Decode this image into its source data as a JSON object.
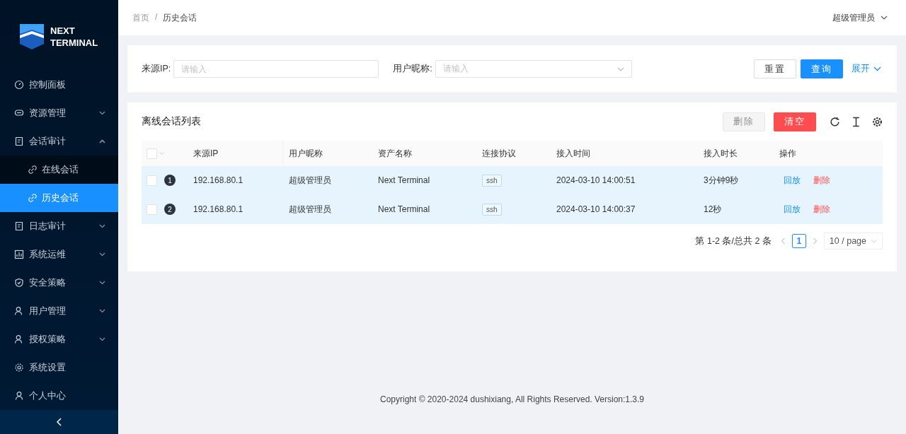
{
  "logo": {
    "line_1": "NEXT",
    "line_2": "TERMINAL"
  },
  "sidebar": {
    "items": [
      {
        "label": "控制面板",
        "selected": false
      },
      {
        "label": "资源管理",
        "selected": false,
        "expanded": false
      },
      {
        "label": "会话审计",
        "selected": false,
        "expanded": true,
        "children": [
          {
            "label": "在线会话",
            "selected": false
          },
          {
            "label": "历史会话",
            "selected": true
          }
        ]
      },
      {
        "label": "日志审计",
        "selected": false,
        "expanded": false
      },
      {
        "label": "系统运维",
        "selected": false,
        "expanded": false
      },
      {
        "label": "安全策略",
        "selected": false,
        "expanded": false
      },
      {
        "label": "用户管理",
        "selected": false,
        "expanded": false
      },
      {
        "label": "授权策略",
        "selected": false,
        "expanded": false
      },
      {
        "label": "系统设置",
        "selected": false
      },
      {
        "label": "个人中心",
        "selected": false
      }
    ]
  },
  "header": {
    "breadcrumb": [
      "首页",
      "历史会话"
    ],
    "separator": "/",
    "user": "超级管理员"
  },
  "search": {
    "fields": [
      {
        "label": "来源IP:",
        "placeholder": "请输入",
        "kind": "text"
      },
      {
        "label": "用户昵称:",
        "placeholder": "请输入",
        "kind": "select"
      }
    ],
    "buttons": [
      {
        "label": "重置",
        "kind": "default"
      },
      {
        "label": "查询",
        "kind": "primary"
      }
    ],
    "expand_link": "展开"
  },
  "table": {
    "title": "离线会话列表",
    "buttons": [
      {
        "label": "删除",
        "kind": "default",
        "disabled": true
      },
      {
        "label": "清空",
        "kind": "danger",
        "disabled": false
      }
    ],
    "select_all_checked": false,
    "columns": [
      "来源IP",
      "用户昵称",
      "资产名称",
      "连接协议",
      "接入时间",
      "接入时长",
      "操作"
    ],
    "rows": [
      {
        "index": "1",
        "checked": false,
        "highlighted": true,
        "ip": "192.168.80.1",
        "user": "超级管理员",
        "asset": "Next Terminal",
        "protocol": "ssh",
        "time": "2024-03-10 14:00:51",
        "duration": "3分钟9秒",
        "actions": [
          {
            "label": "回放",
            "kind": "primary"
          },
          {
            "label": "删除",
            "kind": "danger"
          }
        ]
      },
      {
        "index": "2",
        "checked": false,
        "highlighted": true,
        "ip": "192.168.80.1",
        "user": "超级管理员",
        "asset": "Next Terminal",
        "protocol": "ssh",
        "time": "2024-03-10 14:00:37",
        "duration": "12秒",
        "actions": [
          {
            "label": "回放",
            "kind": "primary"
          },
          {
            "label": "删除",
            "kind": "danger"
          }
        ]
      }
    ],
    "pagination": {
      "summary": "第 1-2 条/总共 2 条",
      "pages": [
        {
          "label": "1",
          "selected": true
        }
      ],
      "page_size": "10 / page"
    }
  },
  "footer": "Copyright © 2020-2024 dushixiang, All Rights Reserved. Version:1.3.9"
}
